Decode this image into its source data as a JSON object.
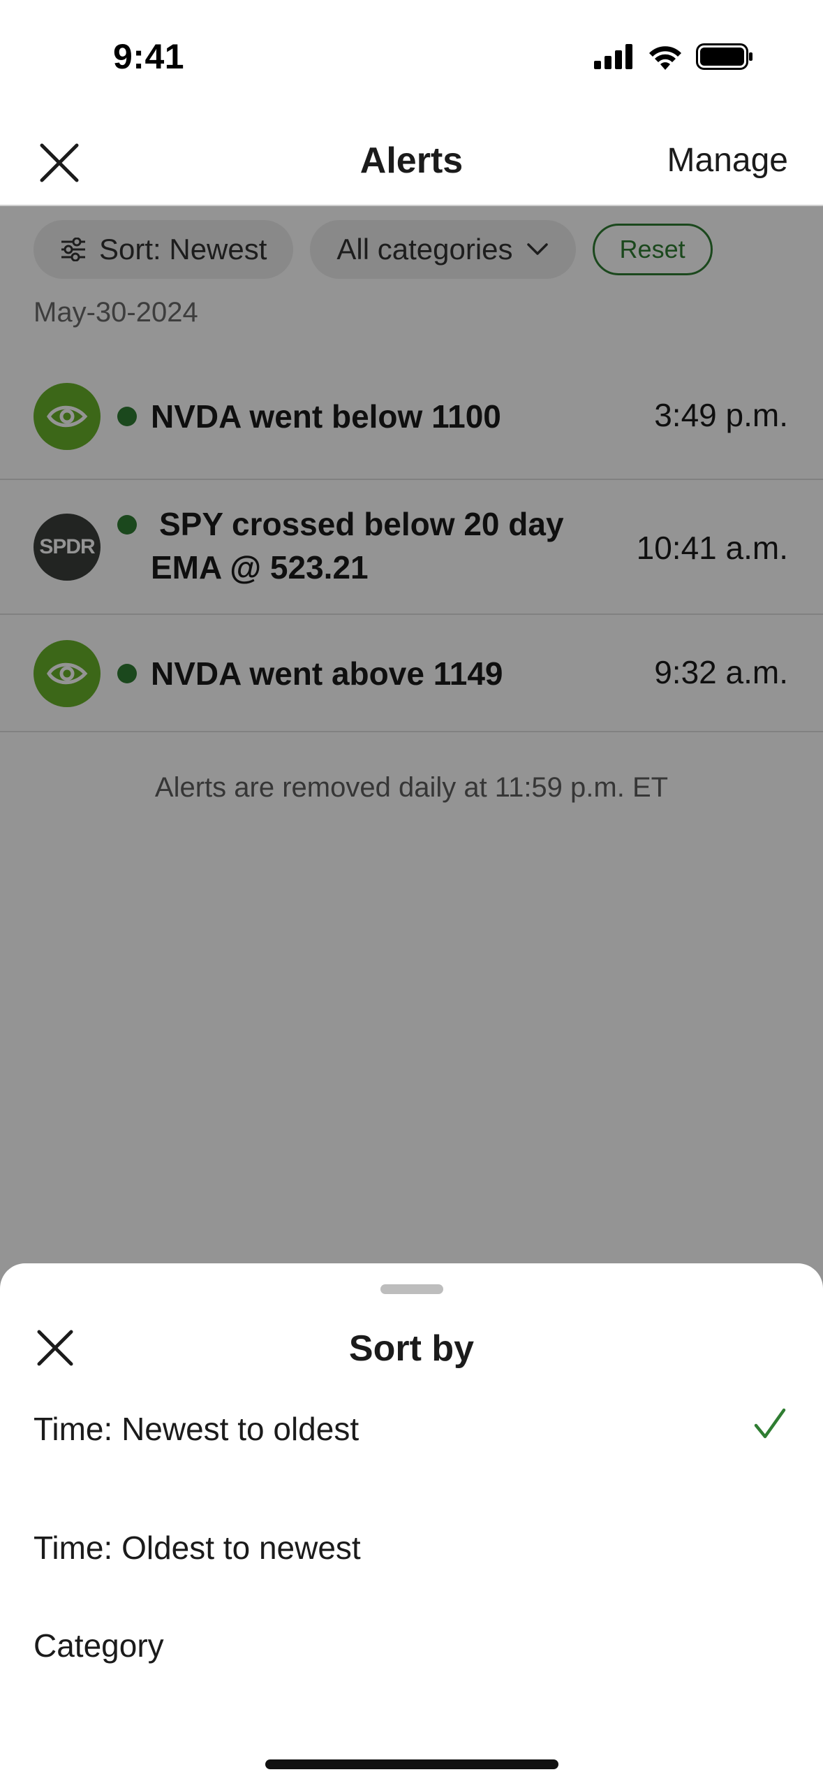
{
  "status_bar": {
    "time": "9:41"
  },
  "header": {
    "title": "Alerts",
    "manage_label": "Manage"
  },
  "filters": {
    "sort_label": "Sort: Newest",
    "category_label": "All categories",
    "reset_label": "Reset"
  },
  "date_label": "May-30-2024",
  "alerts": [
    {
      "logo": "NVDA",
      "text": "NVDA went below 1100",
      "time": "3:49 p.m."
    },
    {
      "logo": "SPDR",
      "text": "SPY crossed below 20 day EMA @ 523.21",
      "time": "10:41 a.m."
    },
    {
      "logo": "NVDA",
      "text": "NVDA went above 1149",
      "time": "9:32 a.m."
    }
  ],
  "footnote": "Alerts are removed daily at 11:59 p.m. ET",
  "sheet": {
    "title": "Sort by",
    "options": [
      {
        "label": "Time: Newest to oldest",
        "selected": true
      },
      {
        "label": "Time: Oldest to newest",
        "selected": false
      },
      {
        "label": "Category",
        "selected": false
      }
    ]
  },
  "colors": {
    "accent": "#2f7d32",
    "nvidia_green": "#68b22a",
    "spdr_dark": "#3b3f3c"
  },
  "icons": [
    "close-icon",
    "signal-icon",
    "wifi-icon",
    "battery-icon",
    "sliders-icon",
    "chevron-down-icon",
    "nvidia-logo",
    "spdr-logo",
    "checkmark-icon"
  ]
}
